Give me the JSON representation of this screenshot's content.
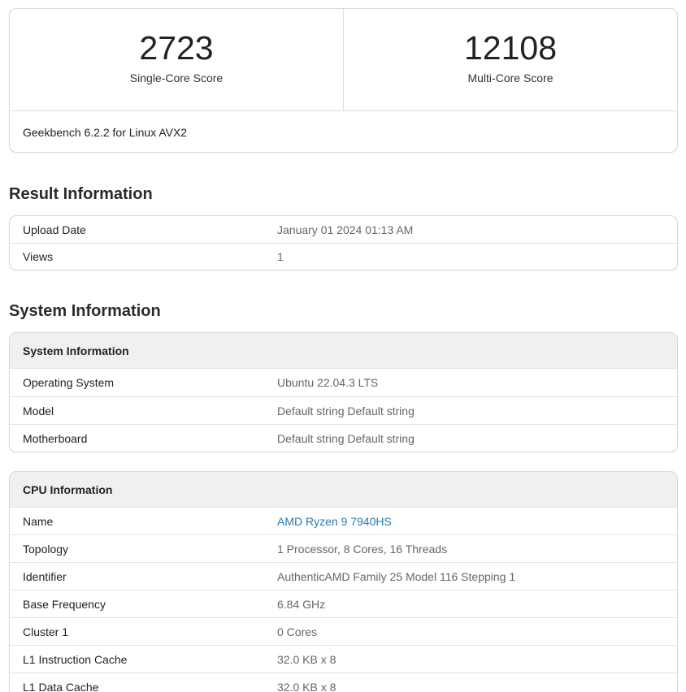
{
  "scores": {
    "single_value": "2723",
    "single_label": "Single-Core Score",
    "multi_value": "12108",
    "multi_label": "Multi-Core Score",
    "version": "Geekbench 6.2.2 for Linux AVX2"
  },
  "result_info": {
    "heading": "Result Information",
    "rows": [
      {
        "label": "Upload Date",
        "value": "January 01 2024 01:13 AM"
      },
      {
        "label": "Views",
        "value": "1"
      }
    ]
  },
  "system_info": {
    "heading": "System Information",
    "card_title": "System Information",
    "rows": [
      {
        "label": "Operating System",
        "value": "Ubuntu 22.04.3 LTS"
      },
      {
        "label": "Model",
        "value": "Default string Default string"
      },
      {
        "label": "Motherboard",
        "value": "Default string Default string"
      }
    ]
  },
  "cpu_info": {
    "card_title": "CPU Information",
    "rows": [
      {
        "label": "Name",
        "value": "AMD Ryzen 9 7940HS"
      },
      {
        "label": "Topology",
        "value": "1 Processor, 8 Cores, 16 Threads"
      },
      {
        "label": "Identifier",
        "value": "AuthenticAMD Family 25 Model 116 Stepping 1"
      },
      {
        "label": "Base Frequency",
        "value": "6.84 GHz"
      },
      {
        "label": "Cluster 1",
        "value": "0 Cores"
      },
      {
        "label": "L1 Instruction Cache",
        "value": "32.0 KB x 8"
      },
      {
        "label": "L1 Data Cache",
        "value": "32.0 KB x 8"
      }
    ]
  },
  "colors": {
    "link": "#2a7ab0",
    "border": "#d9d9d9",
    "header_bg": "#f0f0f0"
  }
}
